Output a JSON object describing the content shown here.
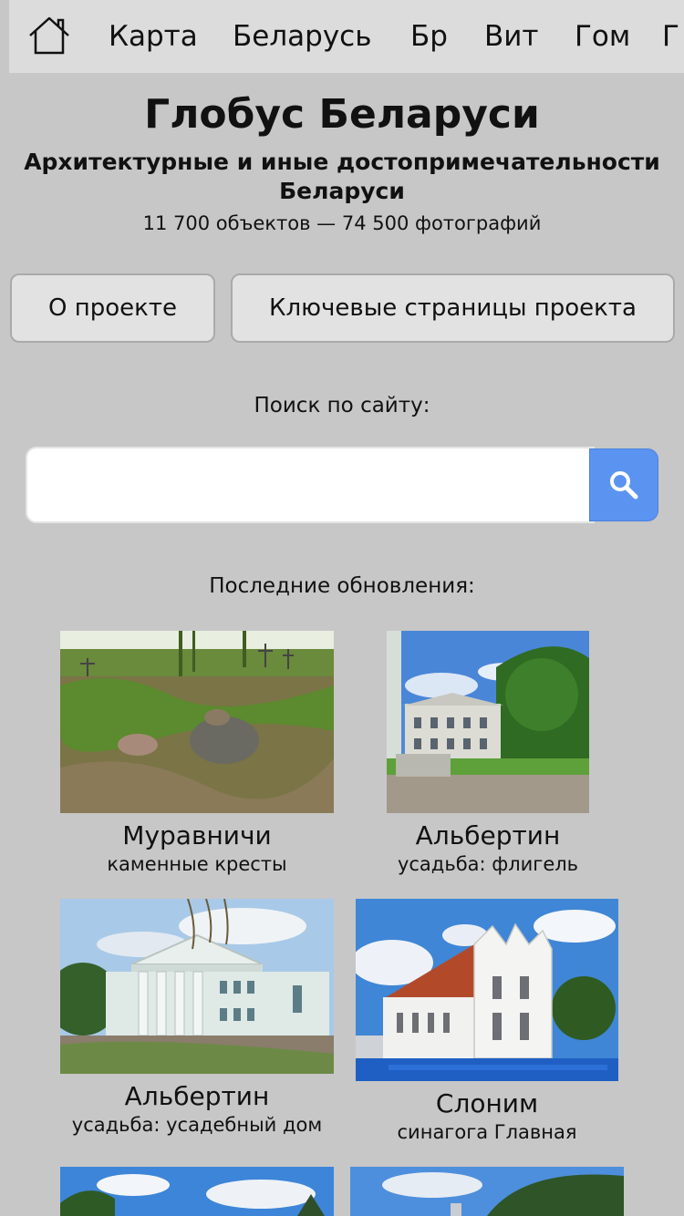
{
  "nav": {
    "items": [
      "Карта",
      "Беларусь",
      "Бр",
      "Вит",
      "Гом",
      "Г"
    ]
  },
  "header": {
    "title": "Глобус Беларуси",
    "subtitle": "Архитектурные и иные достопримечательности Беларуси",
    "stats": "11 700 объектов — 74 500 фотографий"
  },
  "buttons": {
    "about": "О проекте",
    "key_pages": "Ключевые страницы проекта"
  },
  "search": {
    "label": "Поиск по сайту:",
    "value": "",
    "placeholder": ""
  },
  "updates": {
    "label": "Последние обновления:",
    "items": [
      {
        "name": "Муравничи",
        "desc": "каменные кресты"
      },
      {
        "name": "Альбертин",
        "desc": "усадьба: флигель"
      },
      {
        "name": "Альбертин",
        "desc": "усадьба: усадебный дом"
      },
      {
        "name": "Слоним",
        "desc": "синагога Главная"
      }
    ]
  },
  "colors": {
    "background": "#c7c7c7",
    "navbar": "#dcdcdc",
    "search_button": "#5b94f0"
  }
}
